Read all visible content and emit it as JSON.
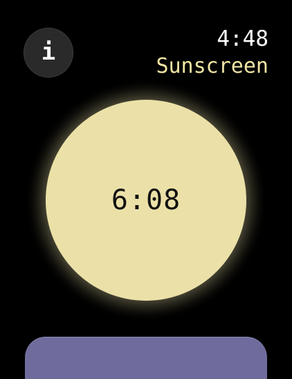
{
  "status_bar": {
    "time": "4:48"
  },
  "header": {
    "app_title": "Sunscreen",
    "info_icon_glyph": "i",
    "info_icon_name": "info-icon"
  },
  "timer": {
    "remaining": "6:08"
  },
  "colors": {
    "background": "#000000",
    "accent": "#f1e4a5",
    "sun": "#ebe1a8",
    "bottom_button": "#6f6c9d"
  }
}
